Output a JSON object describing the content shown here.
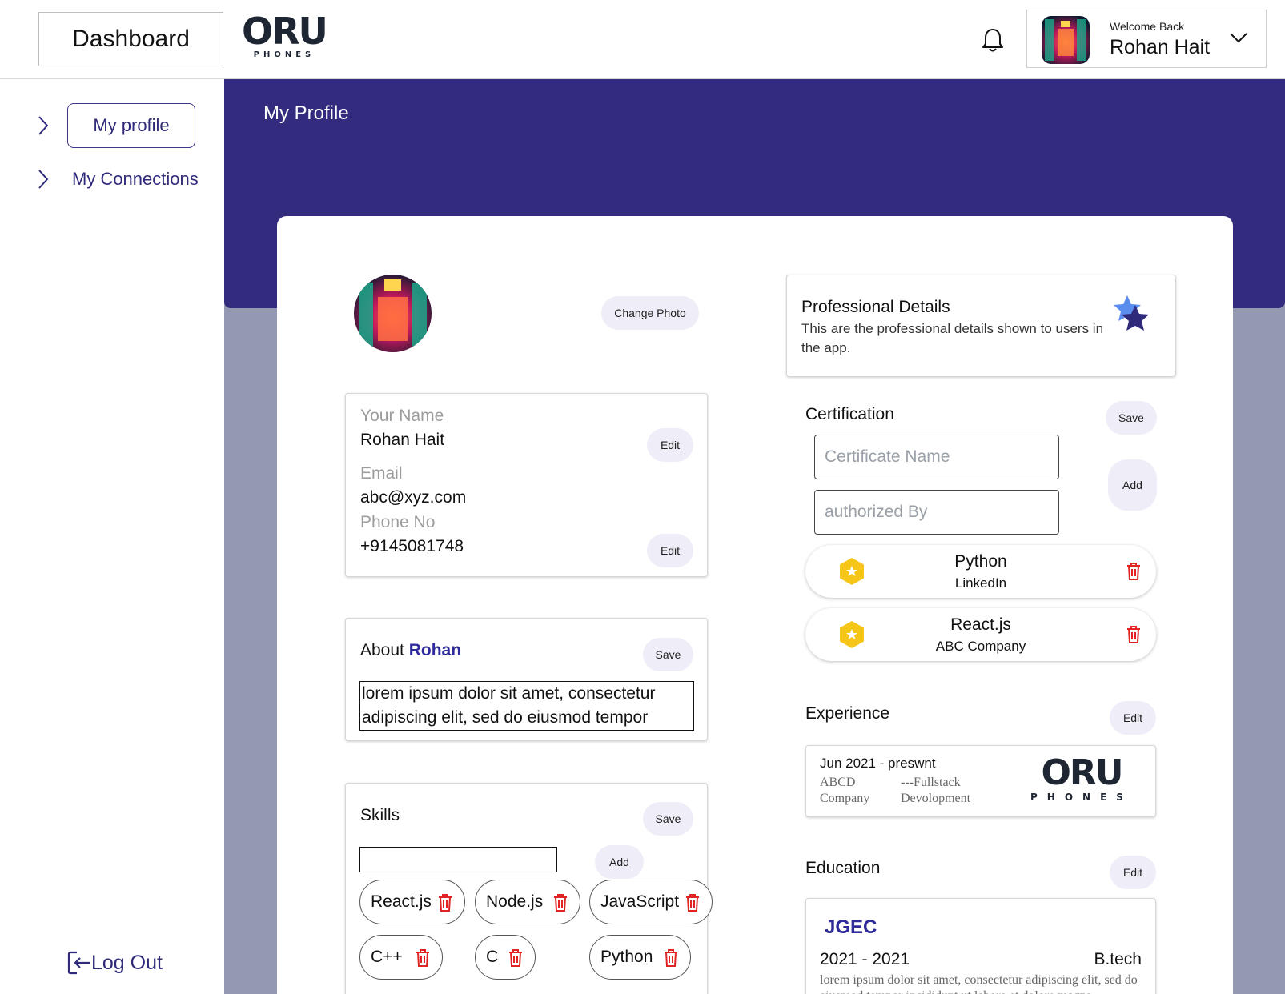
{
  "header": {
    "dashboard_label": "Dashboard",
    "logo_main": "ORU",
    "logo_sub": "PHONES",
    "welcome": "Welcome Back",
    "user_name": "Rohan Hait"
  },
  "sidebar": {
    "items": [
      {
        "label": "My profile"
      },
      {
        "label": "My Connections"
      }
    ],
    "logout": "Log Out"
  },
  "main": {
    "title": "My Profile"
  },
  "profile": {
    "change_photo": "Change Photo",
    "name_label": "Your Name",
    "name_value": "Rohan Hait",
    "email_label": "Email",
    "email_value": "abc@xyz.com",
    "phone_label": "Phone No",
    "phone_value": "+9145081748",
    "edit_label": "Edit"
  },
  "about": {
    "title_prefix": "About ",
    "title_name": "Rohan",
    "save_label": "Save",
    "text": "lorem ipsum dolor sit amet, consectetur adipiscing elit, sed do eiusmod tempor"
  },
  "skills": {
    "title": "Skills",
    "save_label": "Save",
    "add_label": "Add",
    "items": [
      "React.js",
      "Node.js",
      "JavaScript",
      "C++",
      "C",
      "Python"
    ]
  },
  "professional": {
    "title": "Professional Details",
    "description": "This are the professional details shown to users in the app."
  },
  "certification": {
    "title": "Certification",
    "save_label": "Save",
    "add_label": "Add",
    "name_placeholder": "Certificate Name",
    "authority_placeholder": "authorized By",
    "items": [
      {
        "name": "Python",
        "issuer": "LinkedIn"
      },
      {
        "name": "React.js",
        "issuer": "ABC Company"
      }
    ]
  },
  "experience": {
    "title": "Experience",
    "edit_label": "Edit",
    "period": "Jun 2021 - preswnt",
    "company_line1": "ABCD",
    "company_line2": "Company",
    "role_line1": "---Fullstack",
    "role_line2": "Devolopment"
  },
  "education": {
    "title": "Education",
    "edit_label": "Edit",
    "school": "JGEC",
    "period": "2021 - 2021",
    "degree": "B.tech",
    "description": "lorem ipsum dolor sit amet, consectetur adipiscing elit, sed do eiusmod tempor incididunt ut labore et dolore magna"
  },
  "colors": {
    "primary": "#332c7e",
    "main_bg": "#9499b2",
    "accent_name": "#2f2b9a",
    "delete": "#e02424",
    "badge": "#f5c518"
  }
}
